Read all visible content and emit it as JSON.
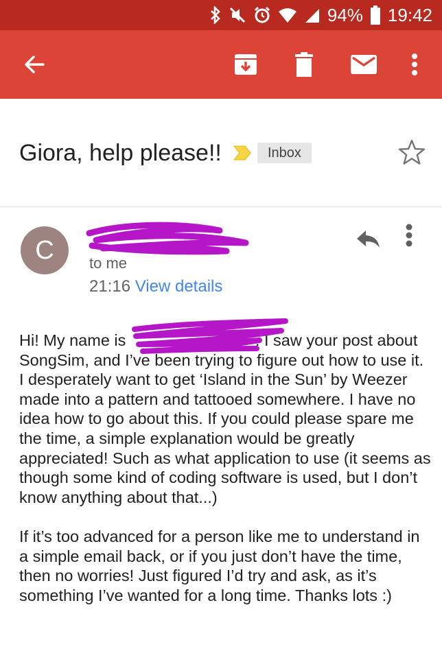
{
  "status_bar": {
    "battery": "94%",
    "time": "19:42",
    "icons": [
      "bluetooth-icon",
      "mute-icon",
      "alarm-icon",
      "wifi-icon",
      "signal-icon",
      "battery-icon"
    ]
  },
  "app_bar": {
    "color": "#db4437",
    "actions": [
      "back-arrow-icon",
      "archive-icon",
      "delete-icon",
      "mark-unread-icon",
      "more-vert-icon"
    ]
  },
  "email": {
    "subject": "Giora, help please!!",
    "label": "Inbox",
    "sender_initial": "C",
    "sender_name": "",
    "recipient": "to me",
    "time": "21:16",
    "view_details": "View details",
    "body": {
      "p1_prefix": "Hi! My name is ",
      "p1_name": "",
      "p1_rest": ". I saw your post about SongSim, and I’ve been trying to figure out how to use it. I desperately want to get ‘Island in the Sun’ by Weezer made into a pattern and tattooed somewhere. I have no idea how to go about this. If you could please spare me the time, a simple explanation would be greatly appreciated! Such as what application to use (it seems as though some kind of coding software is used, but I don’t know anything about that...)",
      "p2": "If it’s too advanced for a person like me to understand in a simple email back, or if you just don’t have the time, then no worries! Just figured I’d try and ask, as it’s something I’ve wanted for a long time. Thanks lots :)"
    }
  }
}
